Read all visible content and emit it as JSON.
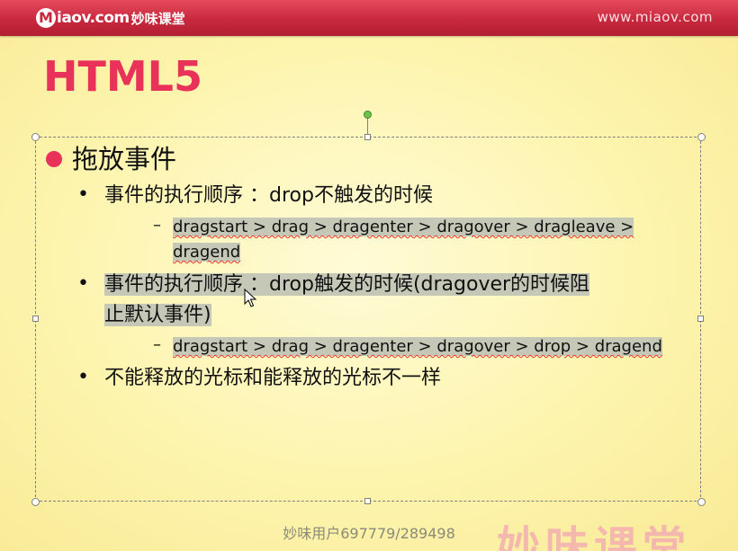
{
  "header": {
    "logo_mark": "M",
    "logo_text": "iaov.com",
    "logo_cn": "妙味课堂",
    "site_url": "www.miaov.com"
  },
  "slide": {
    "title": "HTML5",
    "level1": {
      "text": "拖放事件"
    },
    "items": [
      {
        "text": "事件的执行顺序 ：drop不触发的时候",
        "sub": {
          "line1": "dragstart > drag > dragenter > dragover > dragleave >",
          "line2": "dragend"
        }
      },
      {
        "line1": "事件的执行顺序 ：drop触发的时候(dragover的时候阻",
        "line2": "止默认事件)",
        "sub": {
          "line1": "dragstart > drag > dragenter > dragover > drop > dragend"
        }
      },
      {
        "text": "不能释放的光标和能释放的光标不一样"
      }
    ]
  },
  "footer": {
    "text": "妙味用户697779/289498"
  },
  "watermark": {
    "text": "妙味课堂"
  },
  "colors": {
    "header_red": "#c8283e",
    "title_pink": "#e8325a",
    "slide_bg": "#fdf4ad",
    "highlight": "#c5c8b6"
  }
}
